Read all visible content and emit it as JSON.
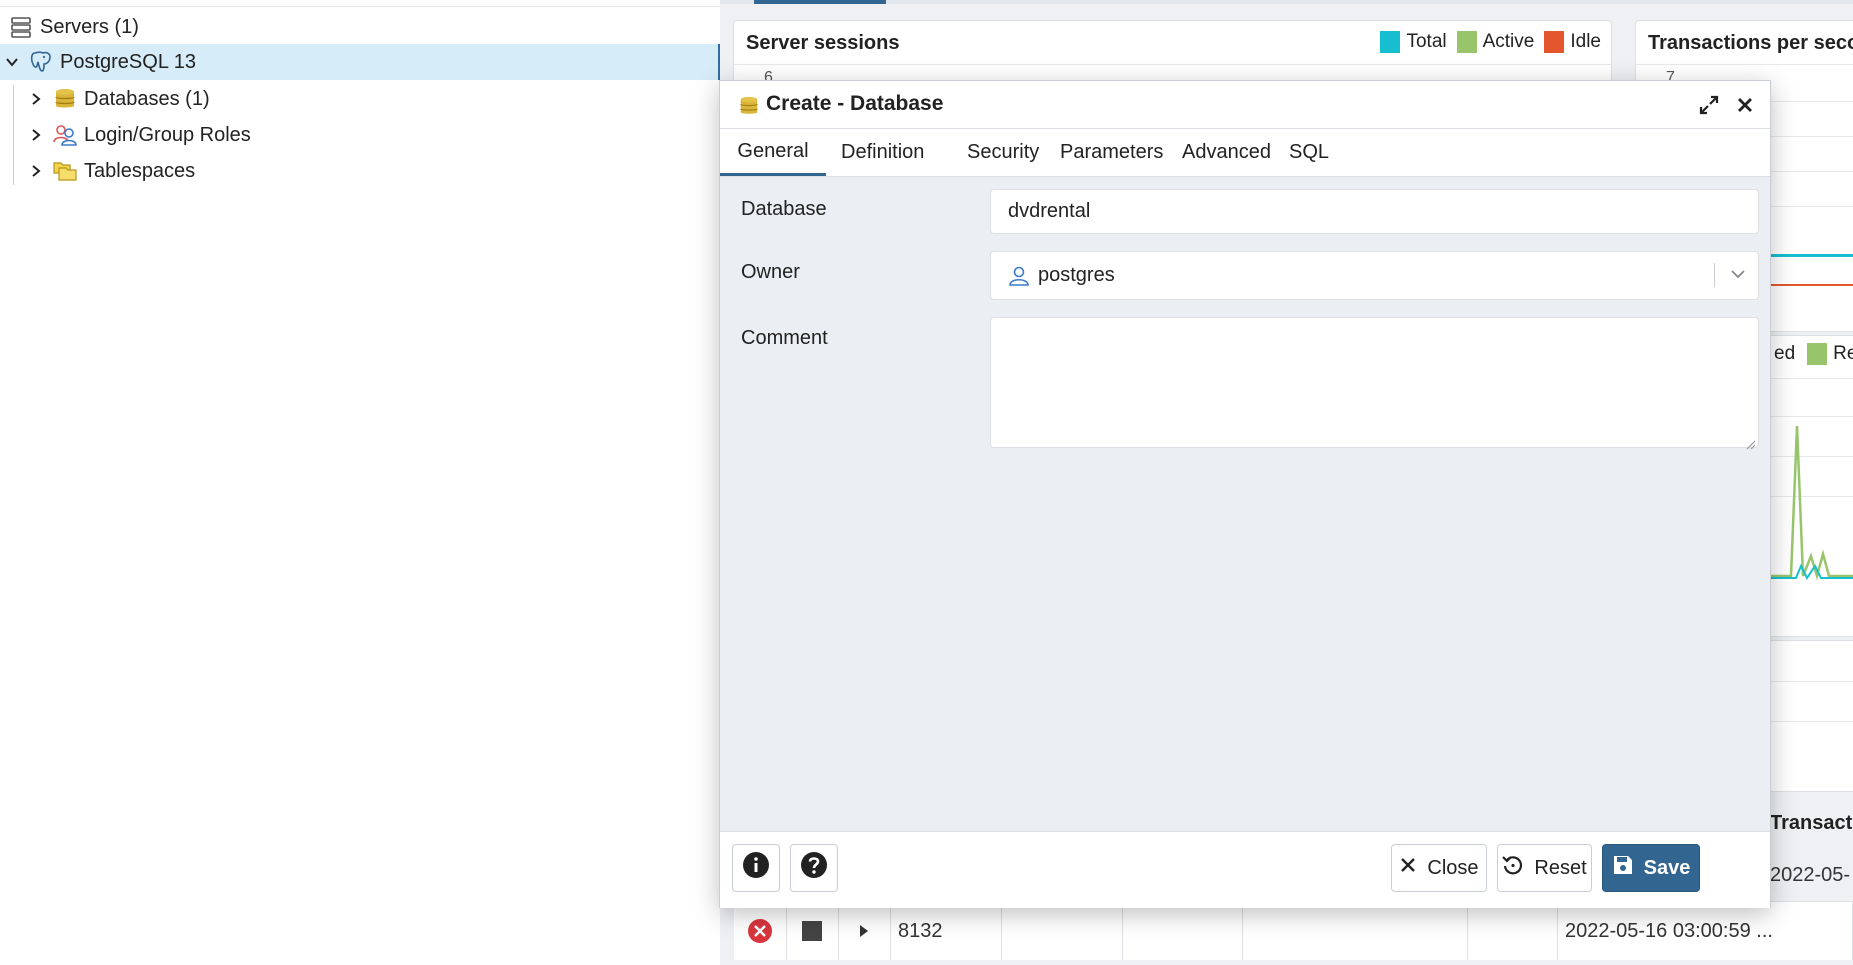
{
  "tree": {
    "servers": "Servers (1)",
    "server": "PostgreSQL 13",
    "databases": "Databases (1)",
    "roles": "Login/Group Roles",
    "tablespaces": "Tablespaces"
  },
  "dashboard": {
    "server_sessions": {
      "title": "Server sessions",
      "legend": [
        {
          "label": "Total",
          "color": "#17becf"
        },
        {
          "label": "Active",
          "color": "#98c56b"
        },
        {
          "label": "Idle",
          "color": "#e4572e"
        }
      ],
      "axis_top": "6"
    },
    "transactions": {
      "title": "Transactions per seco",
      "axis_top": "7"
    },
    "tuples_legend": {
      "partial1": "ed",
      "partial2": "Retu"
    },
    "activity_header_partial": "Transacti",
    "activity_rows": [
      {
        "pid": "8132",
        "start": "2022-05-16 03:00:59 ...",
        "cut": "2022-05-"
      }
    ]
  },
  "dialog": {
    "title": "Create - Database",
    "tabs": [
      "General",
      "Definition",
      "Security",
      "Parameters",
      "Advanced",
      "SQL"
    ],
    "active_tab": "General",
    "fields": {
      "database_label": "Database",
      "database_value": "dvdrental",
      "owner_label": "Owner",
      "owner_value": "postgres",
      "comment_label": "Comment",
      "comment_value": ""
    },
    "buttons": {
      "close": "Close",
      "reset": "Reset",
      "save": "Save"
    }
  },
  "colors": {
    "accent": "#326690",
    "selected_row": "#d6ecf8"
  }
}
